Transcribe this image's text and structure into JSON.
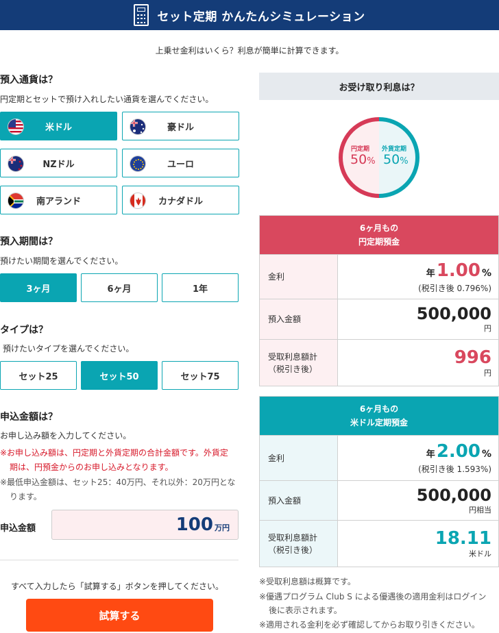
{
  "header": {
    "title": "セット定期 かんたんシミュレーション",
    "icon": "calculator-icon"
  },
  "subtitle": "上乗せ金利はいくら？利息が簡単に計算できます。",
  "currency": {
    "title": "預入通貨は？",
    "desc": "円定期とセットで預け入れしたい通貨を選んでください。",
    "options": [
      {
        "label": "米ドル",
        "flag": "us-flag-icon",
        "selected": true
      },
      {
        "label": "豪ドル",
        "flag": "au-flag-icon",
        "selected": false
      },
      {
        "label": "NZドル",
        "flag": "nz-flag-icon",
        "selected": false
      },
      {
        "label": "ユーロ",
        "flag": "eu-flag-icon",
        "selected": false
      },
      {
        "label": "南アランド",
        "flag": "za-flag-icon",
        "selected": false
      },
      {
        "label": "カナダドル",
        "flag": "ca-flag-icon",
        "selected": false
      }
    ]
  },
  "period": {
    "title": "預入期間は？",
    "desc": "預けたい期間を選んでください。",
    "options": [
      "3ヶ月",
      "6ヶ月",
      "1年"
    ],
    "selected": "3ヶ月"
  },
  "type": {
    "title": "タイプは？",
    "desc": "預けたいタイプを選んでください。",
    "options": [
      "セット25",
      "セット50",
      "セット75"
    ],
    "selected": "セット50"
  },
  "amount": {
    "title": "申込金額は？",
    "desc": "お申し込み額を入力してください。",
    "note_red_1": "※お申し込み額は、円定期と外貨定期の合計金額です。外貨定",
    "note_red_2": "期は、円預金からのお申し込みとなります。",
    "note_gray_1": "※最低申込金額は、セット25：40万円、それ以外：20万円とな",
    "note_gray_2": "ります。",
    "label": "申込金額",
    "value": "100",
    "unit": "万円"
  },
  "calc": {
    "note": "すべて入力したら「試算する」ボタンを押してください。",
    "button": "試算する"
  },
  "result": {
    "title": "お受け取り利息は？",
    "donut": {
      "yen_label": "円定期",
      "yen_pct": "50",
      "yen_share": 0.5,
      "fx_label": "外貨定期",
      "fx_pct": "50",
      "fx_share": 0.5,
      "pct_sign": "%",
      "yen_color": "#d63a57",
      "fx_color": "#0aa5b2"
    },
    "yen": {
      "head_1": "6ヶ月もの",
      "head_2": "円定期預金",
      "rate_label": "金利",
      "rate_prefix": "年",
      "rate": "1.00",
      "rate_pct": "%",
      "rate_after_tax": "(税引き後 0.796%)",
      "deposit_label": "預入金額",
      "deposit": "500,000",
      "deposit_unit": "円",
      "interest_label_1": "受取利息額計",
      "interest_label_2": "（税引き後）",
      "interest": "996",
      "interest_unit": "円",
      "color": "#d9485e"
    },
    "usd": {
      "head_1": "6ヶ月もの",
      "head_2": "米ドル定期預金",
      "rate_label": "金利",
      "rate_prefix": "年",
      "rate": "2.00",
      "rate_pct": "%",
      "rate_after_tax": "(税引き後 1.593%)",
      "deposit_label": "預入金額",
      "deposit": "500,000",
      "deposit_unit": "円相当",
      "interest_label_1": "受取利息額計",
      "interest_label_2": "（税引き後）",
      "interest": "18.11",
      "interest_unit": "米ドル",
      "color": "#0aa5b2"
    },
    "notes": [
      "※受取利息額は概算です。",
      "※優遇プログラム Club S による優遇後の適用金利はログイン",
      "後に表示されます。",
      "※適用される金利を必ず確認してからお取り引きください。"
    ]
  }
}
